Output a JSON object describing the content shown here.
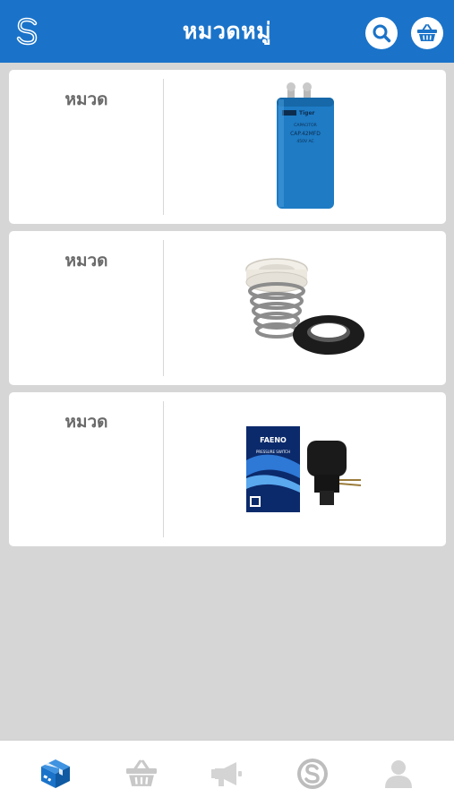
{
  "header": {
    "title": "หมวดหมู่",
    "logo_icon": "s-logo-icon",
    "search_icon": "search-icon",
    "basket_icon": "basket-icon"
  },
  "categories": [
    {
      "label": "หมวด",
      "image": "capacitor-image",
      "image_text": [
        "Tiger",
        "CAPACITOR",
        "CAP.42MFD",
        "450V AC"
      ]
    },
    {
      "label": "หมวด",
      "image": "mechanical-seal-image"
    },
    {
      "label": "หมวด",
      "image": "pressure-switch-image",
      "image_text": [
        "FAENO",
        "PRESSURE SWITCH"
      ]
    }
  ],
  "tabbar": {
    "items": [
      {
        "icon": "box-icon",
        "active": true
      },
      {
        "icon": "basket-icon",
        "active": false
      },
      {
        "icon": "megaphone-icon",
        "active": false
      },
      {
        "icon": "s-coin-icon",
        "active": false
      },
      {
        "icon": "user-icon",
        "active": false
      }
    ]
  },
  "colors": {
    "header": "#1a73c9",
    "background": "#d6d6d6",
    "tab_active": "#1a73c9",
    "tab_inactive": "#c8c8c8"
  }
}
